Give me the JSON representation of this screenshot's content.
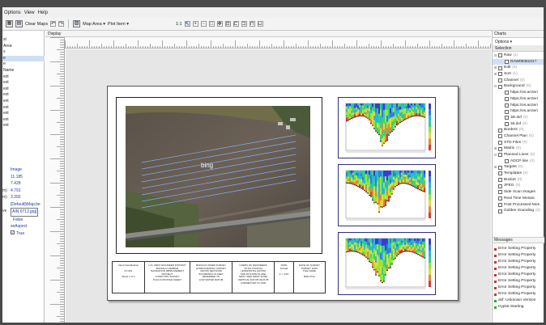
{
  "menu": [
    "Options",
    "View",
    "Help"
  ],
  "toolbar": {
    "clear_maps": "Clear Maps",
    "map_area": "Map Area ▾",
    "plot_item": "Plot Item ▾",
    "zoom": "1:1"
  },
  "left_panel": {
    "list": [
      "st",
      "Area",
      "s",
      "e",
      "e",
      "Name",
      "ext",
      "ext",
      "ext",
      "ext",
      "ext",
      "ext",
      "ext",
      "ext",
      "ext"
    ],
    "properties": [
      {
        "k": "",
        "v": "Image"
      },
      {
        "k": "",
        "v": "11.185"
      },
      {
        "k": "",
        "v": "7.428"
      },
      {
        "k": "m)",
        "v": "4.791"
      },
      {
        "k": "m)",
        "v": "3.392"
      },
      {
        "k": "",
        "v": "[Default]\\Map.be"
      },
      {
        "k": "ve",
        "v": "AIN 0712.jpg]"
      },
      {
        "k": "",
        "v": "False"
      },
      {
        "k": "",
        "v": "seAspect"
      },
      {
        "k": "",
        "v": "True"
      }
    ]
  },
  "display": {
    "title": "Display"
  },
  "map": {
    "watermark": "bing"
  },
  "title_block": [
    "Client Identification\n\nNY-001\n\nSheet 1 of 3",
    "U.S. ARMY ENGINEER DISTRICT\nBUFFALO HARBOR\nNAVIGATION IMPROVEMENT PROJECT\nCONDITION SURVEY\nPLAN & PROFILE SHEET",
    "BUFFALO RIVER SURVEY\nHYDROGRAPHIC SURVEY\nCROSS SECTIONS\nSOUNDINGS IN FEET\nREFERRED TO\nLOW WATER DATUM",
    "CORPS OF ENGINEERS\nTOTAL STATION\nHORIZONTAL DATUM\nNAD 83 STATE PLANE\nNEW YORK WEST ZONE\nVERTICAL DATUM IGLD 85\nCORRECTED TO LWD",
    "DATE\nSCALE\n\n1\" = 100'",
    "DATE OF SURVEY\nSURVEY DATA\nFILE NAME\n\nBAR 0712"
  ],
  "charts_panel": {
    "title": "Charts",
    "options": "Options ▾",
    "selection": "Selection",
    "tree": [
      {
        "label": "Raw",
        "count": "(1)",
        "exp": "⊟",
        "indent": 0
      },
      {
        "label": "RAW0935101?",
        "count": "",
        "exp": "",
        "indent": 1,
        "selected": true
      },
      {
        "label": "Edit",
        "count": "(0)",
        "exp": "⊞",
        "indent": 0
      },
      {
        "label": "Sort",
        "count": "(1)",
        "exp": "⊞",
        "indent": 0
      },
      {
        "label": "Channel",
        "count": "(0)",
        "exp": "",
        "indent": 0
      },
      {
        "label": "Background",
        "count": "(6)",
        "exp": "⊟",
        "indent": 0
      },
      {
        "label": "https://vs.arcteri",
        "count": "",
        "exp": "",
        "indent": 1
      },
      {
        "label": "https://vs.arcteri",
        "count": "",
        "exp": "",
        "indent": 1
      },
      {
        "label": "https://vs.arcteri",
        "count": "",
        "exp": "",
        "indent": 1
      },
      {
        "label": "https://vs.arcteri",
        "count": "",
        "exp": "",
        "indent": 1
      },
      {
        "label": "3D.dxf",
        "count": "(0)",
        "exp": "",
        "indent": 1
      },
      {
        "label": "3d.dxf",
        "count": "(0)",
        "exp": "",
        "indent": 1
      },
      {
        "label": "Borders",
        "count": "(0)",
        "exp": "",
        "indent": 0
      },
      {
        "label": "Channel Plan",
        "count": "(0)",
        "exp": "",
        "indent": 0
      },
      {
        "label": "XTD Files",
        "count": "(0)",
        "exp": "",
        "indent": 0
      },
      {
        "label": "Matrix",
        "count": "(0)",
        "exp": "⊞",
        "indent": 0
      },
      {
        "label": "Planned Lines",
        "count": "(0)",
        "exp": "⊟",
        "indent": 0
      },
      {
        "label": "ADCP line",
        "count": "(0)",
        "exp": "",
        "indent": 1
      },
      {
        "label": "Targets",
        "count": "(0)",
        "exp": "⊞",
        "indent": 0
      },
      {
        "label": "Templates",
        "count": "(0)",
        "exp": "",
        "indent": 0
      },
      {
        "label": "Bucket",
        "count": "(0)",
        "exp": "",
        "indent": 0
      },
      {
        "label": "JPEG",
        "count": "(0)",
        "exp": "",
        "indent": 0
      },
      {
        "label": "Side Scan Images",
        "count": "",
        "exp": "",
        "indent": 0
      },
      {
        "label": "Real Time Mosaic",
        "count": "",
        "exp": "",
        "indent": 0
      },
      {
        "label": "Post Processed Mos",
        "count": "",
        "exp": "",
        "indent": 0
      },
      {
        "label": "Golden Sounding",
        "count": "(0)",
        "exp": "",
        "indent": 0
      }
    ]
  },
  "messages_panel": {
    "title": "Messages",
    "items": [
      {
        "text": "Error Setting Property",
        "ok": false
      },
      {
        "text": "Error Setting Property",
        "ok": false
      },
      {
        "text": "Error Setting Property",
        "ok": false
      },
      {
        "text": "Error Setting Property",
        "ok": false
      },
      {
        "text": "Error Setting Property",
        "ok": false
      },
      {
        "text": "Error Setting Property",
        "ok": false
      },
      {
        "text": "Error Setting Property",
        "ok": false
      },
      {
        "text": "Error Setting Property",
        "ok": false
      },
      {
        "text": "dxf: Unknown Version",
        "ok": true
      },
      {
        "text": "Hyplot Starting",
        "ok": true
      }
    ]
  },
  "colors": {
    "frame": "#4a4a4a",
    "plot_border": "#2f2f7a",
    "link_blue": "#1a3b9a"
  }
}
